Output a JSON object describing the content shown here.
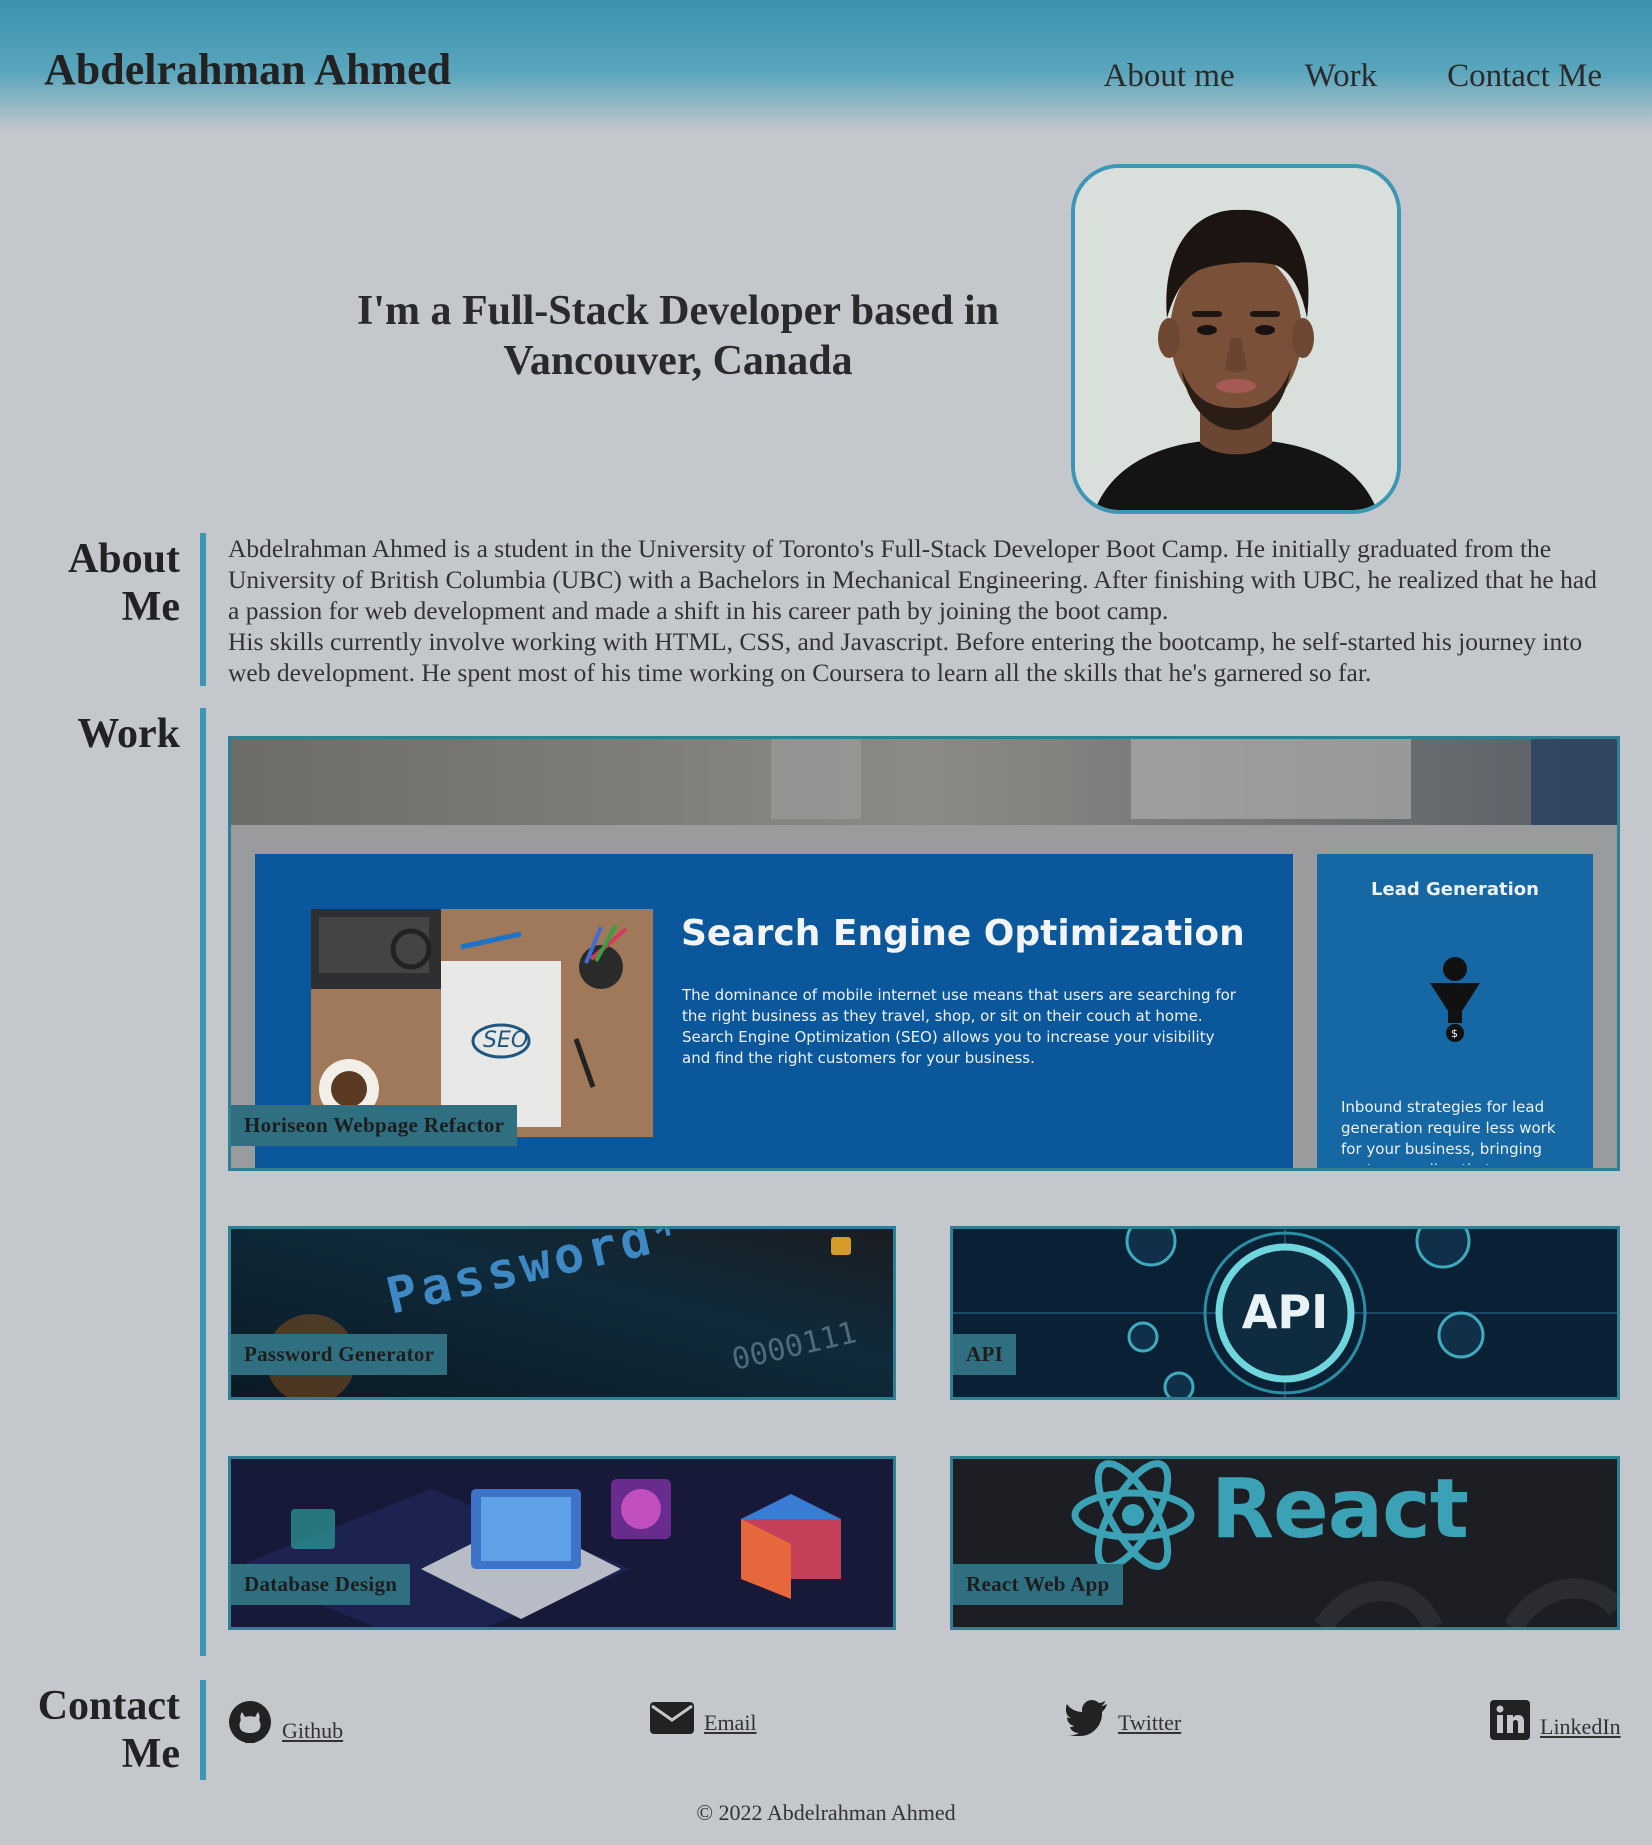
{
  "header": {
    "brand": "Abdelrahman Ahmed",
    "nav": [
      "About me",
      "Work",
      "Contact Me"
    ]
  },
  "hero": {
    "title": "I'm a Full-Stack Developer based in Vancouver, Canada"
  },
  "about": {
    "label": "About Me",
    "paragraphs": [
      "Abdelrahman Ahmed is a student in the University of Toronto's Full-Stack Developer Boot Camp. He initially graduated from the University of British Columbia (UBC) with a Bachelors in Mechanical Engineering. After finishing with UBC, he realized that he had a passion for web development and made a shift in his career path by joining the boot camp.",
      "His skills currently involve working with HTML, CSS, and Javascript. Before entering the bootcamp, he self-started his journey into web development. He spent most of his time working on Coursera to learn all the skills that he's garnered so far."
    ]
  },
  "work": {
    "label": "Work",
    "featured": {
      "title": "Horiseon Webpage Refactor",
      "screenshot": {
        "heading": "Search Engine Optimization",
        "body": "The dominance of mobile internet use means that users are searching for the right business as they travel, shop, or sit on their couch at home. Search Engine Optimization (SEO) allows you to increase your visibility and find the right customers for your business.",
        "side_heading": "Lead Generation",
        "side_body": "Inbound strategies for lead generation require less work for your business, bringing customers directly to your",
        "seo_badge": "SEO"
      }
    },
    "projects": [
      {
        "title": "Password Generator",
        "art_text": "Password****",
        "art_digits": "0000111"
      },
      {
        "title": "API",
        "art_text": "API"
      },
      {
        "title": "Database Design"
      },
      {
        "title": "React Web App",
        "art_text": "React"
      }
    ]
  },
  "contact": {
    "label": "Contact Me",
    "links": [
      {
        "label": "Github",
        "icon": "github-icon"
      },
      {
        "label": "Email",
        "icon": "envelope-icon"
      },
      {
        "label": "Twitter",
        "icon": "twitter-icon"
      },
      {
        "label": "LinkedIn",
        "icon": "linkedin-icon"
      }
    ]
  },
  "footer": {
    "text": "© 2022 Abdelrahman Ahmed"
  },
  "colors": {
    "accent": "#3d97b4",
    "background": "#c4c7cc",
    "label_bg": "#2f6f80"
  }
}
